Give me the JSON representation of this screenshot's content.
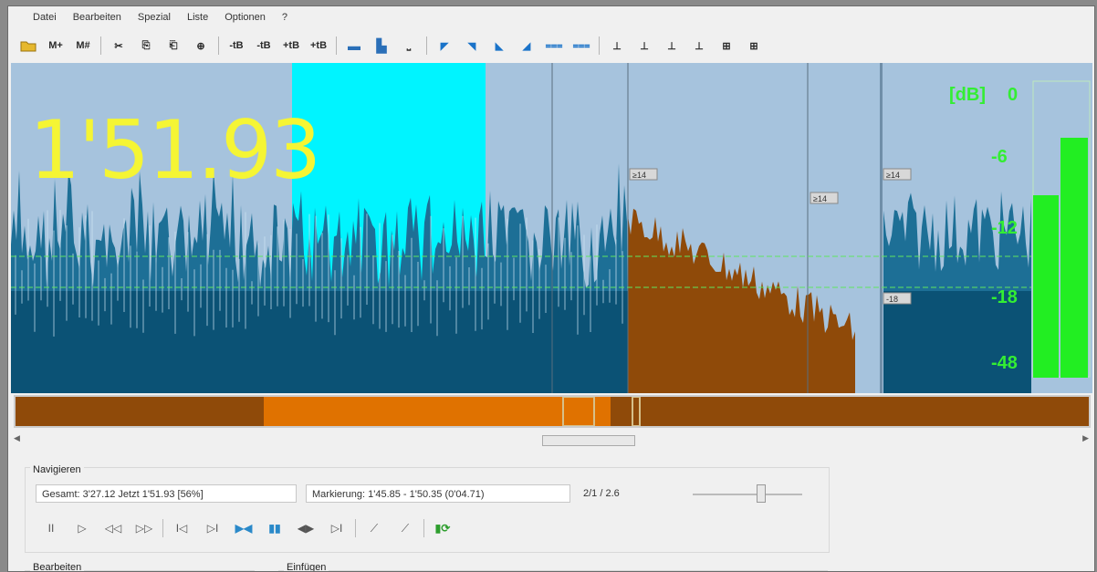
{
  "menu": [
    "Datei",
    "Bearbeiten",
    "Spezial",
    "Liste",
    "Optionen",
    "?"
  ],
  "toolbar": [
    {
      "label": "",
      "icon": "folder-open-icon",
      "cls": ""
    },
    {
      "label": "M+",
      "icon": "add-mark-icon",
      "cls": ""
    },
    {
      "label": "M#",
      "icon": "mark-list-icon",
      "cls": ""
    },
    {
      "sep": true
    },
    {
      "label": "✂",
      "icon": "cut-icon",
      "cls": ""
    },
    {
      "label": "⎘",
      "icon": "copy-icon",
      "cls": ""
    },
    {
      "label": "⎗",
      "icon": "paste-icon",
      "cls": ""
    },
    {
      "label": "⊕",
      "icon": "locate-icon",
      "cls": ""
    },
    {
      "sep": true
    },
    {
      "label": "-tB",
      "icon": "gain-down-icon",
      "cls": ""
    },
    {
      "label": "-tB",
      "icon": "gain-down-2-icon",
      "cls": ""
    },
    {
      "label": "+tB",
      "icon": "gain-up-icon",
      "cls": ""
    },
    {
      "label": "+tB",
      "icon": "gain-up-2-icon",
      "cls": ""
    },
    {
      "sep": true
    },
    {
      "label": "▬",
      "icon": "view-wave-icon",
      "cls": "bar"
    },
    {
      "label": "▙",
      "icon": "view-stereo-icon",
      "cls": "bar"
    },
    {
      "label": "⎵",
      "icon": "view-flat-icon",
      "cls": ""
    },
    {
      "sep": true
    },
    {
      "label": "◤",
      "icon": "fade-in-icon",
      "cls": "blue"
    },
    {
      "label": "◥",
      "icon": "fade-out-icon",
      "cls": "blue"
    },
    {
      "label": "◣",
      "icon": "fade-in-2-icon",
      "cls": "blue"
    },
    {
      "label": "◢",
      "icon": "fade-out-2-icon",
      "cls": "blue"
    },
    {
      "label": "⩶",
      "icon": "crossfade-icon",
      "cls": "blue"
    },
    {
      "label": "⩶",
      "icon": "crossfade-2-icon",
      "cls": "blue"
    },
    {
      "sep": true
    },
    {
      "label": "⊥",
      "icon": "cut-start-icon",
      "cls": ""
    },
    {
      "label": "⊥",
      "icon": "cut-end-icon",
      "cls": ""
    },
    {
      "label": "⊥",
      "icon": "trim-start-icon",
      "cls": ""
    },
    {
      "label": "⊥",
      "icon": "trim-end-icon",
      "cls": ""
    },
    {
      "label": "⊞",
      "icon": "split-icon",
      "cls": ""
    },
    {
      "label": "⊞",
      "icon": "join-icon",
      "cls": ""
    }
  ],
  "display": {
    "time": "1'51.93",
    "vu_unit": "[dB]",
    "vu_scale": [
      "0",
      "-6",
      "-12",
      "-18",
      "-48"
    ]
  },
  "markers": {
    "m1": "≥14",
    "m2": "≥14",
    "m3": "≥14",
    "m4": "-18"
  },
  "colors": {
    "wave_bg": "#a6c3dd",
    "wave_fill": "#0b5275",
    "wave_peak": "#1d6f96",
    "selection": "#00f4ff",
    "brown": "#8f4a09",
    "orange": "#e07200",
    "time_text": "#f5f534",
    "vu_green": "#22ee22"
  },
  "navigation": {
    "title": "Navigieren",
    "position": "Gesamt: 3'27.12   Jetzt 1'51.93   [56%]",
    "range": "Markierung: 1'45.85 - 1'50.35 (0'04.71)",
    "ratio": "2/1 / 2.6"
  },
  "nav_buttons": [
    {
      "label": "II",
      "name": "pause-button",
      "cls": ""
    },
    {
      "label": "▷",
      "name": "play-button",
      "cls": ""
    },
    {
      "label": "◁◁",
      "name": "rewind-button",
      "cls": ""
    },
    {
      "label": "▷▷",
      "name": "fast-forward-button",
      "cls": ""
    },
    {
      "sep": true
    },
    {
      "label": "I◁",
      "name": "go-start-button",
      "cls": ""
    },
    {
      "label": "▷I",
      "name": "go-end-button",
      "cls": ""
    },
    {
      "label": "▶◀",
      "name": "mark-in-button",
      "cls": "blue"
    },
    {
      "label": "▮▮",
      "name": "mark-range-button",
      "cls": "blue"
    },
    {
      "label": "◀▶",
      "name": "mark-out-button",
      "cls": ""
    },
    {
      "label": "▷I",
      "name": "play-marked-button",
      "cls": ""
    },
    {
      "sep": true
    },
    {
      "label": "⟋",
      "name": "zoom-in-button",
      "cls": ""
    },
    {
      "label": "⟋",
      "name": "zoom-out-button",
      "cls": ""
    },
    {
      "sep": true
    },
    {
      "label": "▮⟳",
      "name": "loop-button",
      "cls": "green"
    }
  ],
  "bottom": {
    "left_label": "Bearbeiten",
    "right_label": "Einfügen"
  }
}
